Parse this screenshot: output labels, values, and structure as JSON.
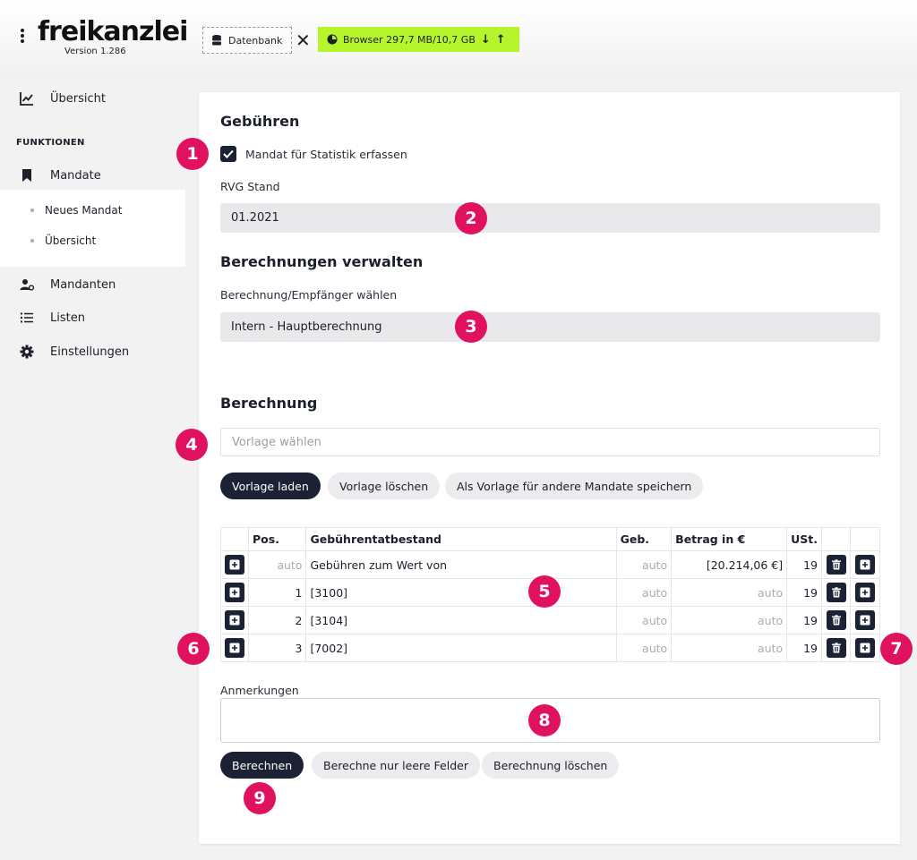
{
  "header": {
    "logo": "freikanzlei",
    "version": "Version 1.286",
    "db_label": "Datenbank",
    "browser_label": "Browser 297,7 MB/10,7 GB",
    "browser_color": "#b6f52c",
    "down_arrow": "↓",
    "up_arrow": "↑",
    "close": "✕"
  },
  "sidebar": {
    "overview": "Übersicht",
    "section_label": "FUNKTIONEN",
    "mandate": "Mandate",
    "sub_items": [
      "Neues Mandat",
      "Übersicht"
    ],
    "mandanten": "Mandanten",
    "listen": "Listen",
    "einstellungen": "Einstellungen"
  },
  "main": {
    "fees_title": "Gebühren",
    "checkbox_label": "Mandat für Statistik erfassen",
    "checkbox_checked": true,
    "rvg_label": "RVG Stand",
    "rvg_value": "01.2021",
    "manage_title": "Berechnungen verwalten",
    "recipient_label": "Berechnung/Empfänger wählen",
    "recipient_value": "Intern - Hauptberechnung",
    "calc_title": "Berechnung",
    "template_placeholder": "Vorlage wählen",
    "buttons": {
      "load": "Vorlage laden",
      "delete": "Vorlage löschen",
      "save": "Als Vorlage für andere Mandate speichern"
    },
    "table": {
      "headers": [
        "",
        "Pos.",
        "Gebührentatbestand",
        "Geb.",
        "Betrag in €",
        "USt.",
        "",
        ""
      ],
      "rows": [
        {
          "pos": "auto",
          "desc": "Gebühren zum Wert von",
          "geb": "auto",
          "amount": "[20.214,06 €]",
          "ust": "19"
        },
        {
          "pos": "1",
          "desc": "[3100]",
          "geb": "auto",
          "amount": "auto",
          "ust": "19"
        },
        {
          "pos": "2",
          "desc": "[3104]",
          "geb": "auto",
          "amount": "auto",
          "ust": "19"
        },
        {
          "pos": "3",
          "desc": "[7002]",
          "geb": "auto",
          "amount": "auto",
          "ust": "19"
        }
      ]
    },
    "notes_label": "Anmerkungen",
    "notes_value": "",
    "bottom_buttons": {
      "calc": "Berechnen",
      "calc_empty": "Berechne nur leere Felder",
      "delete_calc": "Berechnung löschen"
    }
  },
  "markers": [
    "1",
    "2",
    "3",
    "4",
    "5",
    "6",
    "7",
    "8",
    "9"
  ],
  "colors": {
    "marker": "#e0115f",
    "dark_button": "#1b2233"
  }
}
